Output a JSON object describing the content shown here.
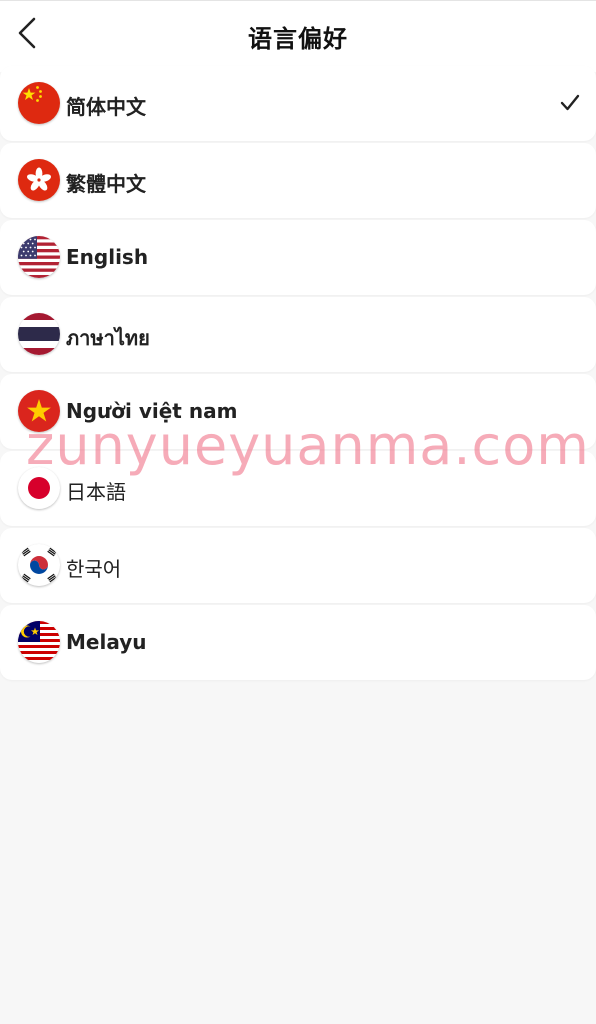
{
  "header": {
    "title": "语言偏好",
    "back_icon": "chevron-left-icon"
  },
  "languages": [
    {
      "label": "简体中文",
      "flag": "china-flag-icon",
      "selected": true
    },
    {
      "label": "繁體中文",
      "flag": "hong-kong-flag-icon",
      "selected": false
    },
    {
      "label": "English",
      "flag": "us-flag-icon",
      "selected": false
    },
    {
      "label": "ภาษาไทย",
      "flag": "thailand-flag-icon",
      "selected": false
    },
    {
      "label": "Người việt nam",
      "flag": "vietnam-flag-icon",
      "selected": false
    },
    {
      "label": "日本語",
      "flag": "japan-flag-icon",
      "selected": false
    },
    {
      "label": "한국어",
      "flag": "korea-flag-icon",
      "selected": false
    },
    {
      "label": "Melayu",
      "flag": "malaysia-flag-icon",
      "selected": false
    }
  ],
  "selected_icon": "checkmark-icon",
  "watermark": "zunyueyuanma.com",
  "colors": {
    "background": "#f7f7f7",
    "card": "#ffffff",
    "text": "#222222",
    "watermark": "#f0788c"
  }
}
